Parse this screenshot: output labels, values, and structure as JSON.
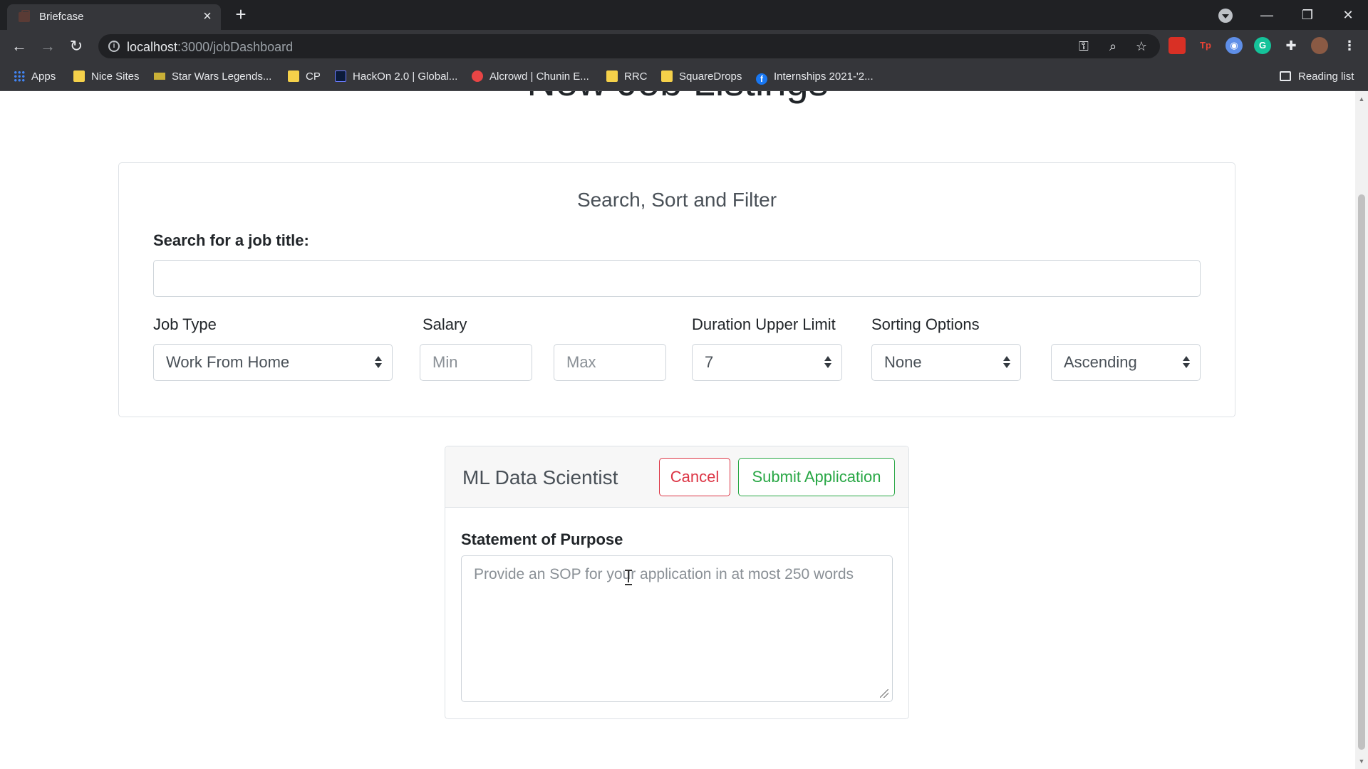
{
  "browser": {
    "tab_title": "Briefcase",
    "url_host": "localhost",
    "url_path": ":3000/jobDashboard",
    "bookmarks": [
      {
        "label": "Apps",
        "icon": "apps-grid-icon"
      },
      {
        "label": "Nice Sites",
        "icon": "folder-icon"
      },
      {
        "label": "Star Wars Legends...",
        "icon": "star-wars-icon"
      },
      {
        "label": "CP",
        "icon": "folder-icon"
      },
      {
        "label": "HackOn 2.0 | Global...",
        "icon": "hackon-icon"
      },
      {
        "label": "Alcrowd | Chunin E...",
        "icon": "aicrowd-icon"
      },
      {
        "label": "RRC",
        "icon": "folder-icon"
      },
      {
        "label": "SquareDrops",
        "icon": "folder-icon"
      },
      {
        "label": "Internships 2021-'2...",
        "icon": "facebook-icon"
      }
    ],
    "reading_list": "Reading list"
  },
  "page": {
    "heading": "New Job Listings"
  },
  "filters": {
    "title": "Search, Sort and Filter",
    "search_label": "Search for a job title:",
    "search_value": "",
    "job_type_label": "Job Type",
    "job_type_value": "Work From Home",
    "salary_label": "Salary",
    "salary_min_placeholder": "Min",
    "salary_max_placeholder": "Max",
    "duration_label": "Duration Upper Limit",
    "duration_value": "7",
    "sorting_label": "Sorting Options",
    "sorting_value": "None",
    "order_value": "Ascending"
  },
  "application": {
    "job_title": "ML Data Scientist",
    "cancel_label": "Cancel",
    "submit_label": "Submit Application",
    "sop_label": "Statement of Purpose",
    "sop_placeholder": "Provide an SOP for your application in at most 250 words",
    "sop_value": ""
  },
  "colors": {
    "danger": "#dc3545",
    "success": "#28a745",
    "chrome_dark": "#202124",
    "chrome_toolbar": "#35363a"
  }
}
